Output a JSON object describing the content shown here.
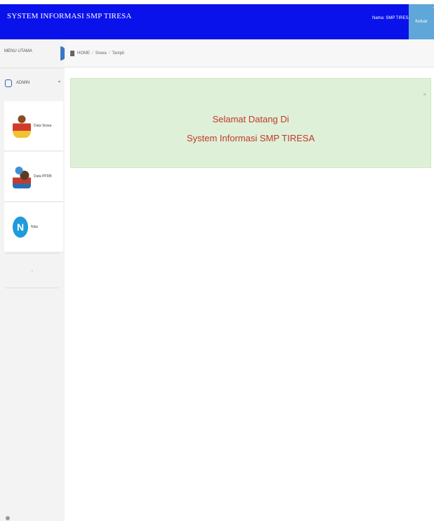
{
  "header": {
    "brand": "SYSTEM INFORMASI SMP TIRESA",
    "user_name": "Nama: SMP TIRESA",
    "logout_label": "Keluar",
    "color": "#0a12ec"
  },
  "sidebar": {
    "title": "MENU UTAMA",
    "user_label": "ADMIN",
    "items": [
      {
        "label": "Data Siswa",
        "icon": "student-icon"
      },
      {
        "label": "Data PPDB",
        "icon": "ppdb-icon"
      },
      {
        "label": "Nilai",
        "icon": "grade-icon"
      }
    ]
  },
  "breadcrumb": {
    "home": "HOME",
    "section": "Siswa",
    "page": "Tampil"
  },
  "welcome": {
    "line1": "Selamat Datang Di",
    "line2": "System Informasi SMP TIRESA",
    "close": "×",
    "background": "#dff0d8",
    "text_color": "#c0392b"
  },
  "icons": {
    "nilai_letter": "N"
  }
}
